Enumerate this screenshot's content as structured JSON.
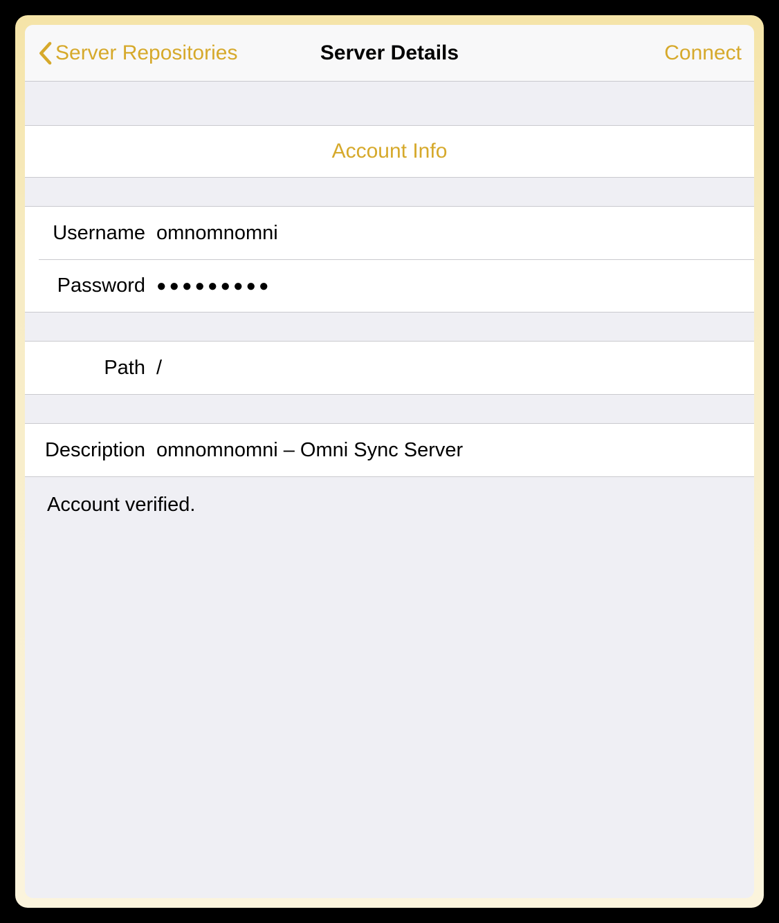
{
  "navbar": {
    "back_label": "Server Repositories",
    "title": "Server Details",
    "action_label": "Connect"
  },
  "links": {
    "account_info": "Account Info"
  },
  "fields": {
    "username_label": "Username",
    "username_value": "omnomnomni",
    "password_label": "Password",
    "password_display": "●●●●●●●●●",
    "path_label": "Path",
    "path_value": "/",
    "description_label": "Description",
    "description_value": "omnomnomni – Omni Sync Server"
  },
  "status": {
    "message": "Account verified."
  },
  "colors": {
    "accent": "#d6a92b",
    "background": "#efeff4",
    "cell": "#ffffff",
    "separator": "#c9c9ce"
  }
}
